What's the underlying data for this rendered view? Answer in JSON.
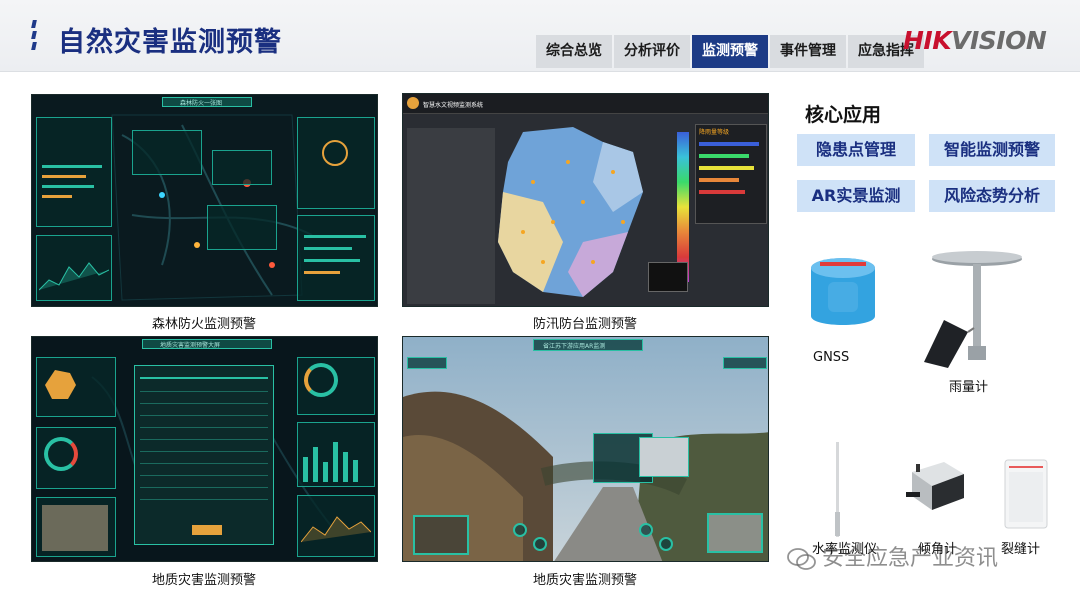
{
  "header": {
    "title": "自然灾害监测预警",
    "tabs": [
      "综合总览",
      "分析评价",
      "监测预警",
      "事件管理",
      "应急指挥"
    ],
    "active_tab": 2,
    "logo": {
      "part1": "HIK",
      "part2": "VISION"
    }
  },
  "screens": [
    {
      "caption": "森林防火监测预警",
      "ui_title": "森林防火一张图"
    },
    {
      "caption": "防汛防台监测预警",
      "ui_title": "智慧水文视频监测系统",
      "legend_title": "降雨量等级"
    },
    {
      "caption": "地质灾害监测预警",
      "ui_title": "地质灾害监测预警大屏"
    },
    {
      "caption": "地质灾害监测预警",
      "ui_title": "省江苏下游应用AR监测"
    }
  ],
  "core": {
    "title": "核心应用",
    "tags": [
      "隐患点管理",
      "智能监测预警",
      "AR实景监测",
      "风险态势分析"
    ]
  },
  "devices": [
    {
      "name": "GNSS",
      "icon": "gnss-receiver-icon"
    },
    {
      "name": "雨量计",
      "icon": "rain-gauge-icon"
    },
    {
      "name": "水率监测仪",
      "icon": "water-meter-icon"
    },
    {
      "name": "倾角计",
      "icon": "inclinometer-icon"
    },
    {
      "name": "裂缝计",
      "icon": "crack-meter-icon"
    }
  ],
  "watermark": "安全应急产业资讯",
  "colors": {
    "brand_blue": "#1a2f80",
    "active_tab": "#1d3b86",
    "tag_bg": "#cfe2f7",
    "logo_red": "#c8102e"
  }
}
